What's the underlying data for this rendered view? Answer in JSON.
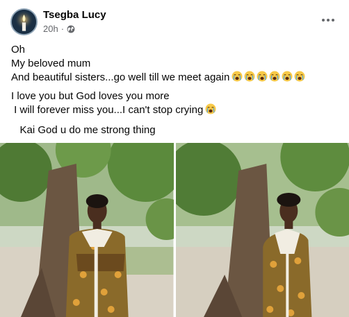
{
  "post": {
    "author": "Tsegba Lucy",
    "time": "20h",
    "separator": "·",
    "audience_icon": "globe-icon",
    "menu_icon": "more-options-icon",
    "lines": [
      "Oh",
      "My beloved mum",
      "And beautiful sisters...go well till we meet again",
      "I love you but God loves you more",
      " I will forever miss you...I can't stop crying",
      "   Kai God u do me strong thing"
    ],
    "emoji_name": "loudly-crying-face-emoji"
  },
  "photos": [
    {
      "name": "photo-woman-by-tree-1"
    },
    {
      "name": "photo-woman-by-tree-2"
    }
  ],
  "colors": {
    "secondary_text": "#65676b",
    "primary_text": "#050505"
  }
}
